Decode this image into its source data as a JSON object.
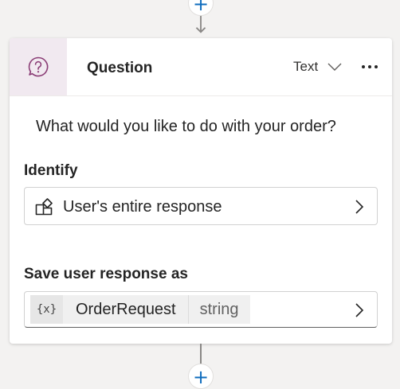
{
  "flow": {
    "add_node_top_glyph": "+",
    "add_node_bottom_glyph": "+"
  },
  "node": {
    "icon": "question-bubble-icon",
    "title": "Question",
    "type_selector": {
      "value": "Text"
    },
    "more_options": "ellipsis-icon",
    "prompt": "What would you like to do with your order?",
    "identify": {
      "label": "Identify",
      "value": "User's entire response",
      "icon": "entity-shapes-icon"
    },
    "save_as": {
      "label": "Save user response as",
      "variable_icon_text": "{x}",
      "variable_name": "OrderRequest",
      "variable_type": "string"
    }
  },
  "colors": {
    "accent": "#0f6cbd",
    "icon_bg": "#f1e9f0",
    "icon_fg": "#8a3c75"
  }
}
